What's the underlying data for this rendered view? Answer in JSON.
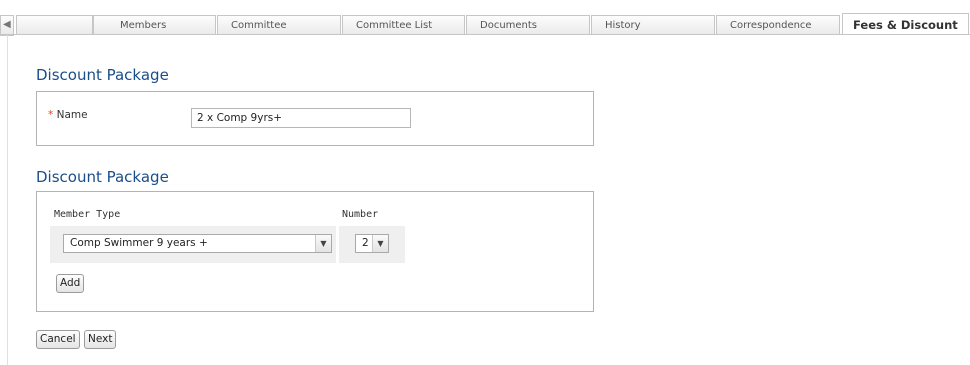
{
  "tabs": {
    "items": [
      {
        "label": ""
      },
      {
        "label": "Members"
      },
      {
        "label": "Committee"
      },
      {
        "label": "Committee List"
      },
      {
        "label": "Documents"
      },
      {
        "label": "History"
      },
      {
        "label": "Correspondence"
      },
      {
        "label": "Fees & Discount"
      }
    ],
    "active": "Fees & Discount"
  },
  "section1": {
    "title": "Discount Package",
    "name_label": "Name",
    "required_mark": "*",
    "name_value": "2 x Comp 9yrs+"
  },
  "section2": {
    "title": "Discount Package",
    "col_member_type": "Member Type",
    "col_number": "Number",
    "member_type_value": "Comp Swimmer 9 years +",
    "number_value": "2",
    "add_label": "Add"
  },
  "footer": {
    "cancel_label": "Cancel",
    "next_label": "Next"
  },
  "colors": {
    "title": "#1a4e8a",
    "required": "#e4442a"
  }
}
